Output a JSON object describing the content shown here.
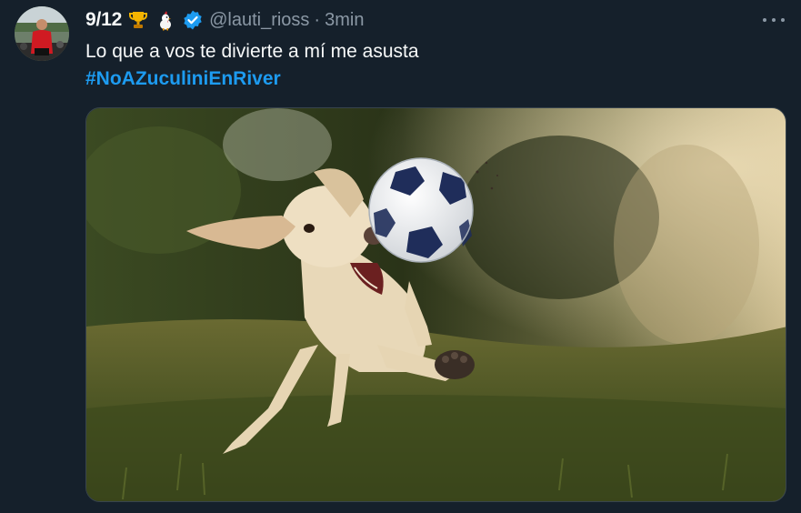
{
  "tweet": {
    "display_name": "9/12",
    "handle": "@lauti_rioss",
    "separator": "·",
    "time": "3min",
    "text": "Lo que a vos te divierte a mí me asusta",
    "hashtag": "#NoAZuculiniEnRiver",
    "icons": {
      "trophy": "trophy-icon",
      "chicken": "chicken-icon",
      "verified": "verified-badge-icon",
      "more": "more-options-icon"
    }
  },
  "colors": {
    "background": "#15202b",
    "text_primary": "#f7f9f9",
    "text_secondary": "#8b98a5",
    "accent": "#1d9bf0"
  }
}
